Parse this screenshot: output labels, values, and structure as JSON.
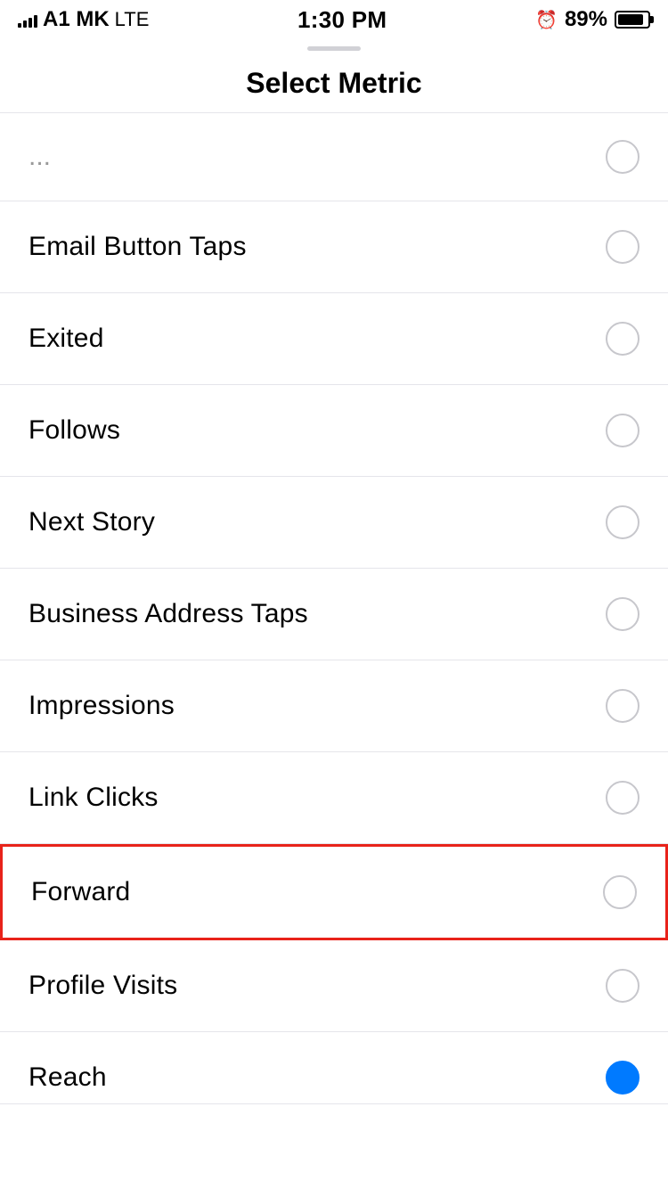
{
  "statusBar": {
    "carrier": "A1 MK",
    "network": "LTE",
    "time": "1:30 PM",
    "battery": "89%"
  },
  "header": {
    "title": "Select Metric"
  },
  "partialItem": {
    "label": "..."
  },
  "metrics": [
    {
      "id": "email-button-taps",
      "label": "Email Button Taps",
      "selected": false,
      "highlighted": false
    },
    {
      "id": "exited",
      "label": "Exited",
      "selected": false,
      "highlighted": false
    },
    {
      "id": "follows",
      "label": "Follows",
      "selected": false,
      "highlighted": false
    },
    {
      "id": "next-story",
      "label": "Next Story",
      "selected": false,
      "highlighted": false
    },
    {
      "id": "business-address-taps",
      "label": "Business Address Taps",
      "selected": false,
      "highlighted": false
    },
    {
      "id": "impressions",
      "label": "Impressions",
      "selected": false,
      "highlighted": false
    },
    {
      "id": "link-clicks",
      "label": "Link Clicks",
      "selected": false,
      "highlighted": false
    },
    {
      "id": "forward",
      "label": "Forward",
      "selected": false,
      "highlighted": true
    },
    {
      "id": "profile-visits",
      "label": "Profile Visits",
      "selected": false,
      "highlighted": false
    },
    {
      "id": "reach",
      "label": "Reach",
      "selected": true,
      "highlighted": false
    }
  ]
}
